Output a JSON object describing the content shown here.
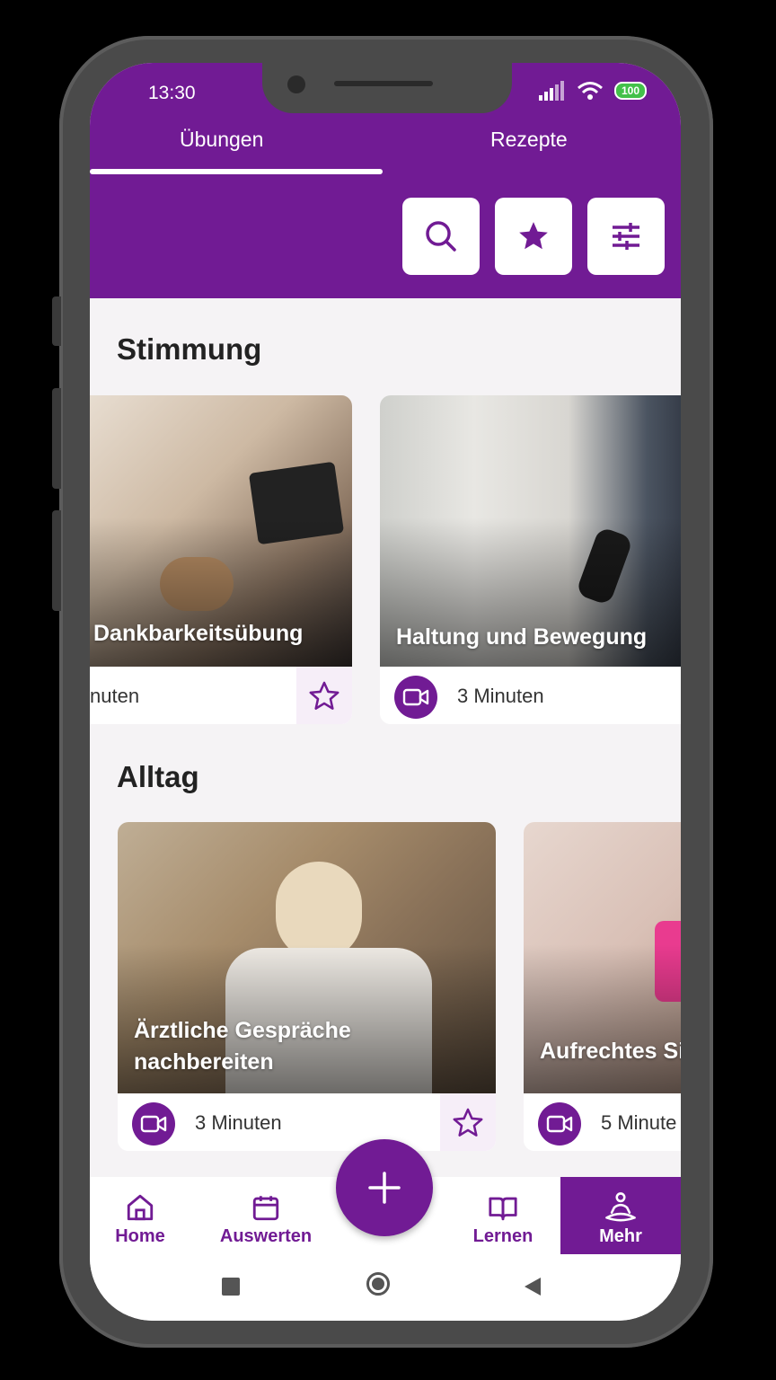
{
  "status_bar": {
    "time": "13:30",
    "battery": "100"
  },
  "tabs": [
    {
      "label": "Übungen",
      "active": true
    },
    {
      "label": "Rezepte",
      "active": false
    }
  ],
  "header_actions": [
    {
      "icon": "search-icon"
    },
    {
      "icon": "star-icon"
    },
    {
      "icon": "filter-sliders-icon"
    }
  ],
  "sections": [
    {
      "title": "Stimmung",
      "cards": [
        {
          "title": "Dankbarkeitsübung",
          "duration": "nuten",
          "type_icon": "video-icon",
          "favorite_icon": "star-outline-icon"
        },
        {
          "title": "Haltung und Bewegung",
          "duration": "3 Minuten",
          "type_icon": "video-icon"
        }
      ]
    },
    {
      "title": "Alltag",
      "cards": [
        {
          "title_line1": "Ärztliche Gespräche",
          "title_line2": "nachbereiten",
          "duration": "3 Minuten",
          "type_icon": "video-icon",
          "favorite_icon": "star-outline-icon"
        },
        {
          "title": "Aufrechtes Si",
          "duration": "5 Minute",
          "type_icon": "video-icon"
        }
      ]
    }
  ],
  "bottom_nav": [
    {
      "label": "Home",
      "icon": "home-icon"
    },
    {
      "label": "Auswerten",
      "icon": "calendar-icon"
    },
    {
      "label": "Lernen",
      "icon": "book-icon"
    },
    {
      "label": "Mehr",
      "icon": "meditation-icon",
      "active": true
    }
  ],
  "fab": {
    "icon": "plus-icon"
  },
  "colors": {
    "primary": "#711b94",
    "background": "#f5f3f5",
    "favorite_bg": "#f6eef8"
  }
}
